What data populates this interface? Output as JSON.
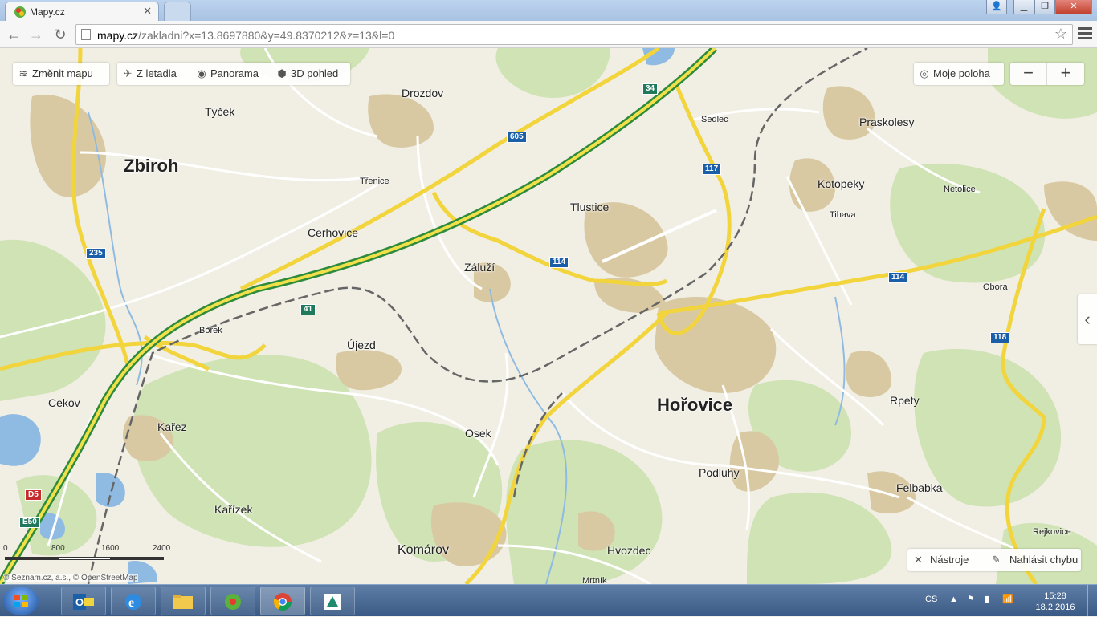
{
  "browser": {
    "active_tab_title": "Mapy.cz",
    "url_host": "mapy.cz",
    "url_path": "/zakladni?x=13.8697880&y=49.8370212&z=13&l=0"
  },
  "map_toolbar": {
    "change_map": "Změnit mapu",
    "aerial": "Z letadla",
    "panorama": "Panorama",
    "view3d": "3D pohled",
    "my_location": "Moje poloha",
    "zoom_out": "−",
    "zoom_in": "+"
  },
  "bottom_tools": {
    "tools": "Nástroje",
    "report": "Nahlásit chybu"
  },
  "scale": {
    "labels": [
      "0",
      "800",
      "1600",
      "2400"
    ]
  },
  "attribution": "© Seznam.cz, a.s., © OpenStreetMap",
  "places": {
    "zbiroh": "Zbiroh",
    "horovice": "Hořovice",
    "tycek": "Týček",
    "drozdov": "Drozdov",
    "trenice": "Třenice",
    "cerhovice": "Cerhovice",
    "borek": "Borek",
    "ujezd": "Újezd",
    "zaluzi": "Záluží",
    "tlustice": "Tlustice",
    "sedlec": "Sedlec",
    "praskolesy": "Praskolesy",
    "kotopeky": "Kotopeky",
    "tihava": "Tihava",
    "netolice": "Netolice",
    "obora": "Obora",
    "rpety": "Rpety",
    "felbabka": "Felbabka",
    "rejkovice": "Rejkovice",
    "podluhy": "Podluhy",
    "hvozdec": "Hvozdec",
    "mrtnik": "Mrtník",
    "komarov": "Komárov",
    "osek": "Osek",
    "karez": "Kařez",
    "karizek": "Kařízek",
    "cekov": "Cekov"
  },
  "road_numbers": {
    "r34": "34",
    "r605": "605",
    "r117": "117",
    "r235": "235",
    "r114a": "114",
    "r114b": "114",
    "r41": "41",
    "r118": "118",
    "d5": "D5",
    "e50": "E50"
  },
  "taskbar": {
    "language": "CS",
    "time": "15:28",
    "date": "18.2.2016"
  }
}
